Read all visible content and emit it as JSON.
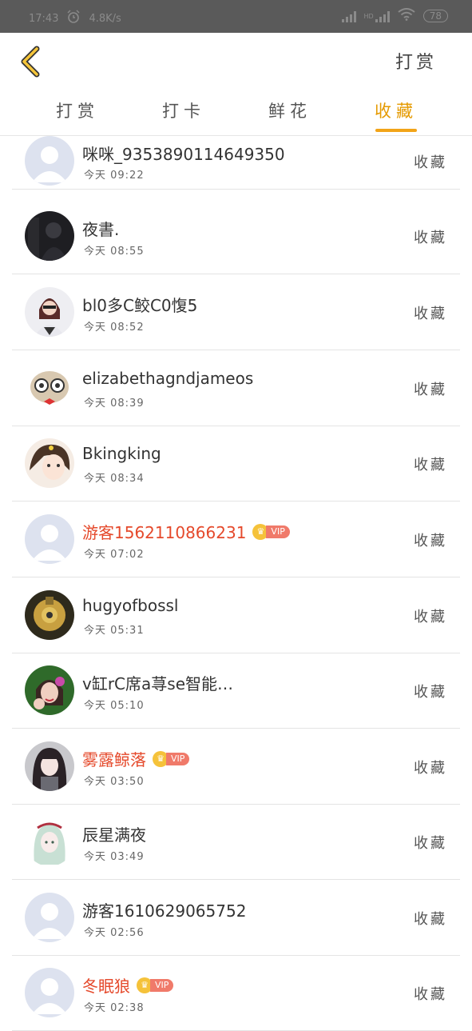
{
  "status_bar": {
    "time": "17:43",
    "speed": "4.8K/s",
    "network": "HD",
    "battery": "78"
  },
  "header": {
    "action_label": "打赏"
  },
  "tabs": [
    {
      "label": "打赏",
      "active": false
    },
    {
      "label": "打卡",
      "active": false
    },
    {
      "label": "鲜花",
      "active": false
    },
    {
      "label": "收藏",
      "active": true
    }
  ],
  "vip_label": "VIP",
  "items": [
    {
      "name": "咪咪_9353890114649350",
      "time": "今天 09:22",
      "action": "收藏",
      "vip": false,
      "avatar": "default"
    },
    {
      "name": "夜書.",
      "time": "今天 08:55",
      "action": "收藏",
      "vip": false,
      "avatar": "dark"
    },
    {
      "name": "bl0多C鲛C0愎5",
      "time": "今天 08:52",
      "action": "收藏",
      "vip": false,
      "avatar": "girl"
    },
    {
      "name": "elizabethagndjameos",
      "time": "今天 08:39",
      "action": "收藏",
      "vip": false,
      "avatar": "cat"
    },
    {
      "name": "Bkingking",
      "time": "今天 08:34",
      "action": "收藏",
      "vip": false,
      "avatar": "anime-girl"
    },
    {
      "name": "游客1562110866231",
      "time": "今天 07:02",
      "action": "收藏",
      "vip": true,
      "avatar": "default"
    },
    {
      "name": "hugyofbossl",
      "time": "今天 05:31",
      "action": "收藏",
      "vip": false,
      "avatar": "toy"
    },
    {
      "name": "v缸rC席a荨se智能…",
      "time": "今天 05:10",
      "action": "收藏",
      "vip": false,
      "avatar": "flower-girl"
    },
    {
      "name": "雾露鲸落",
      "time": "今天 03:50",
      "action": "收藏",
      "vip": true,
      "avatar": "anime-dark"
    },
    {
      "name": "辰星满夜",
      "time": "今天 03:49",
      "action": "收藏",
      "vip": false,
      "avatar": "anime-light"
    },
    {
      "name": "游客1610629065752",
      "time": "今天 02:56",
      "action": "收藏",
      "vip": false,
      "avatar": "default"
    },
    {
      "name": "冬眠狼",
      "time": "今天 02:38",
      "action": "收藏",
      "vip": true,
      "avatar": "default"
    }
  ],
  "colors": {
    "accent": "#f2a418",
    "vip_name": "#e5492b",
    "status_bar": "#5a5a5a"
  }
}
